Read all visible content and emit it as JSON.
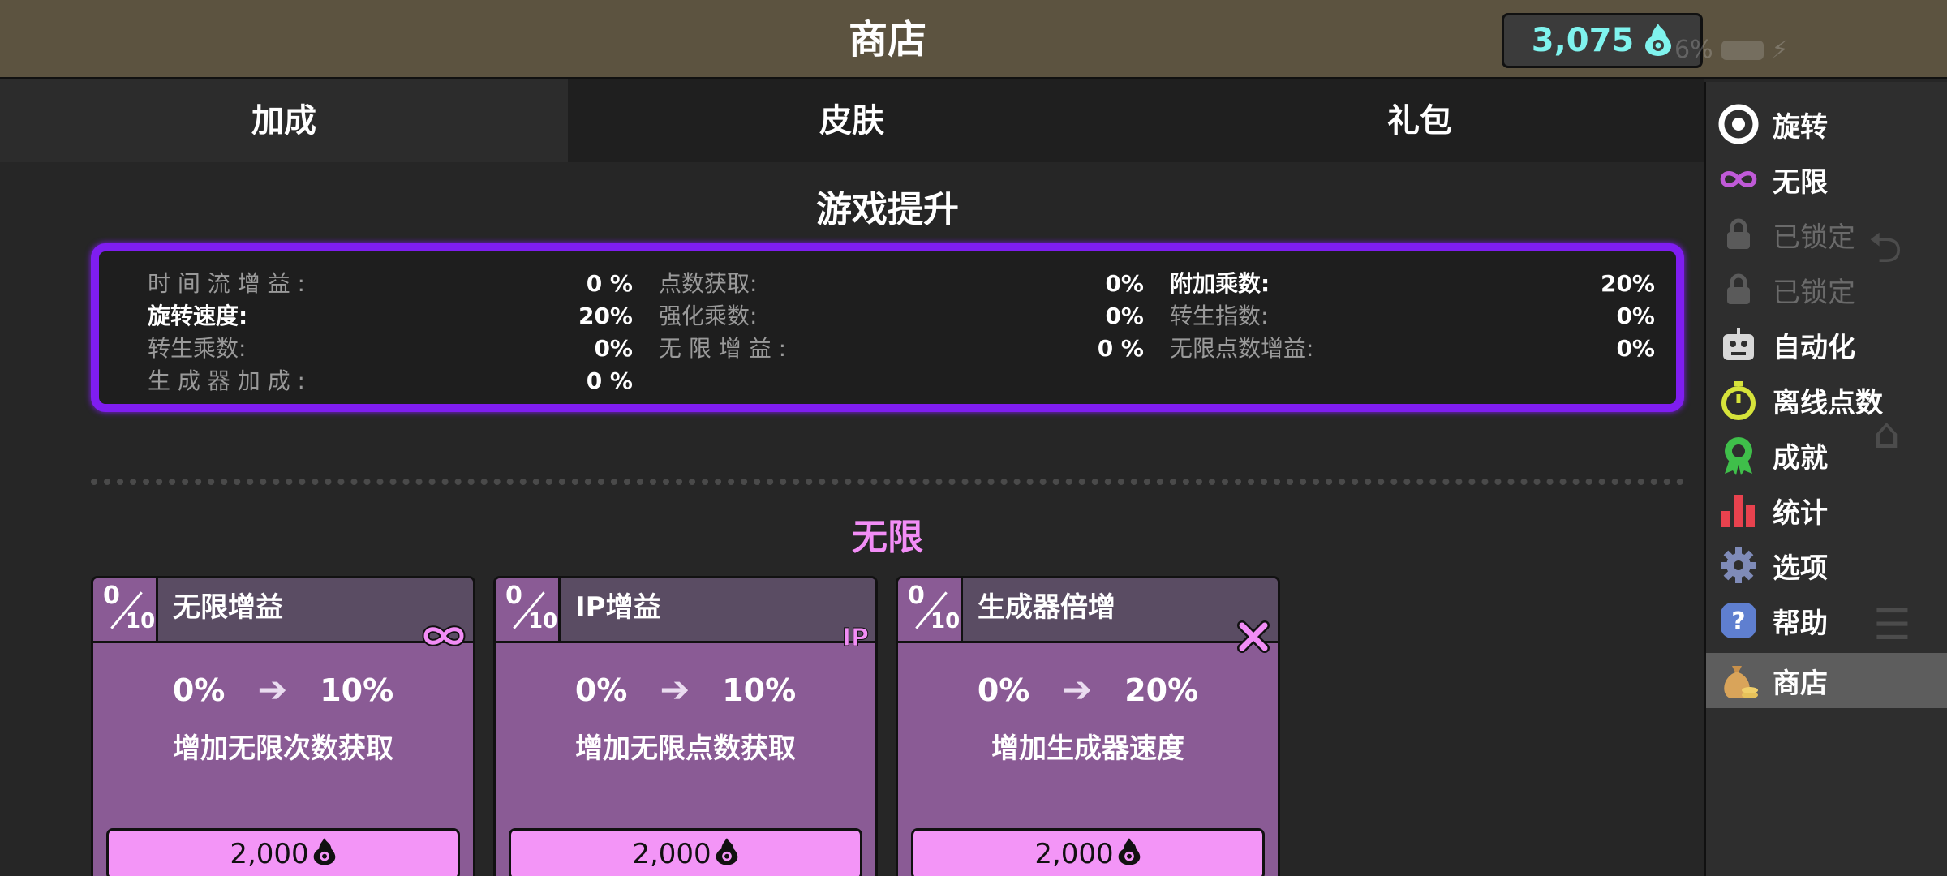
{
  "header": {
    "title": "商店"
  },
  "currency": {
    "value": "3,075",
    "icon": "flame-coin-icon",
    "color": "#7ff3ee"
  },
  "status": {
    "battery": "6%"
  },
  "tabs": [
    {
      "label": "加成",
      "active": true
    },
    {
      "label": "皮肤",
      "active": false
    },
    {
      "label": "礼包",
      "active": false
    }
  ],
  "boosts": {
    "title": "游戏提升",
    "border_color": "#7f1df1",
    "stats": [
      {
        "label": "时 间 流 增 益 :",
        "value": "0 %",
        "bright": false
      },
      {
        "label": "点数获取:",
        "value": "0%",
        "bright": false
      },
      {
        "label": "附加乘数:",
        "value": "20%",
        "bright": true
      },
      {
        "label": "旋转速度:",
        "value": "20%",
        "bright": true
      },
      {
        "label": "强化乘数:",
        "value": "0%",
        "bright": false
      },
      {
        "label": "转生指数:",
        "value": "0%",
        "bright": false
      },
      {
        "label": "转生乘数:",
        "value": "0%",
        "bright": false
      },
      {
        "label": "无 限 增 益 :",
        "value": "0 %",
        "bright": false
      },
      {
        "label": "无限点数增益:",
        "value": "0%",
        "bright": false
      },
      {
        "label": "生 成 器 加 成 :",
        "value": "0 %",
        "bright": false
      }
    ]
  },
  "infinity": {
    "title": "无限",
    "title_color": "#f28df6",
    "cards": [
      {
        "count": "0",
        "max": "10",
        "name": "无限增益",
        "badge": "∞",
        "badge_icon": "infinity-icon",
        "from": "0%",
        "to": "10%",
        "desc": "增加无限次数获取",
        "price": "2,000"
      },
      {
        "count": "0",
        "max": "10",
        "name": "IP增益",
        "badge": "IP",
        "badge_icon": "ip-icon",
        "from": "0%",
        "to": "10%",
        "desc": "增加无限点数获取",
        "price": "2,000"
      },
      {
        "count": "0",
        "max": "10",
        "name": "生成器倍增",
        "badge": "✕",
        "badge_icon": "multiply-icon",
        "from": "0%",
        "to": "20%",
        "desc": "增加生成器速度",
        "price": "2,000"
      }
    ]
  },
  "sidebar": {
    "items": [
      {
        "label": "旋转",
        "icon": "spin-target-icon",
        "locked": false,
        "active": false
      },
      {
        "label": "无限",
        "icon": "infinity-icon",
        "locked": false,
        "active": false
      },
      {
        "label": "已锁定",
        "icon": "lock-icon",
        "locked": true,
        "active": false
      },
      {
        "label": "已锁定",
        "icon": "lock-icon",
        "locked": true,
        "active": false
      },
      {
        "label": "自动化",
        "icon": "robot-icon",
        "locked": false,
        "active": false
      },
      {
        "label": "离线点数",
        "icon": "stopwatch-icon",
        "locked": false,
        "active": false
      },
      {
        "label": "成就",
        "icon": "award-ribbon-icon",
        "locked": false,
        "active": false
      },
      {
        "label": "统计",
        "icon": "bar-chart-icon",
        "locked": false,
        "active": false
      },
      {
        "label": "选项",
        "icon": "gear-icon",
        "locked": false,
        "active": false
      },
      {
        "label": "帮助",
        "icon": "help-icon",
        "locked": false,
        "active": false
      },
      {
        "label": "商店",
        "icon": "money-bag-icon",
        "locked": false,
        "active": true
      }
    ]
  }
}
